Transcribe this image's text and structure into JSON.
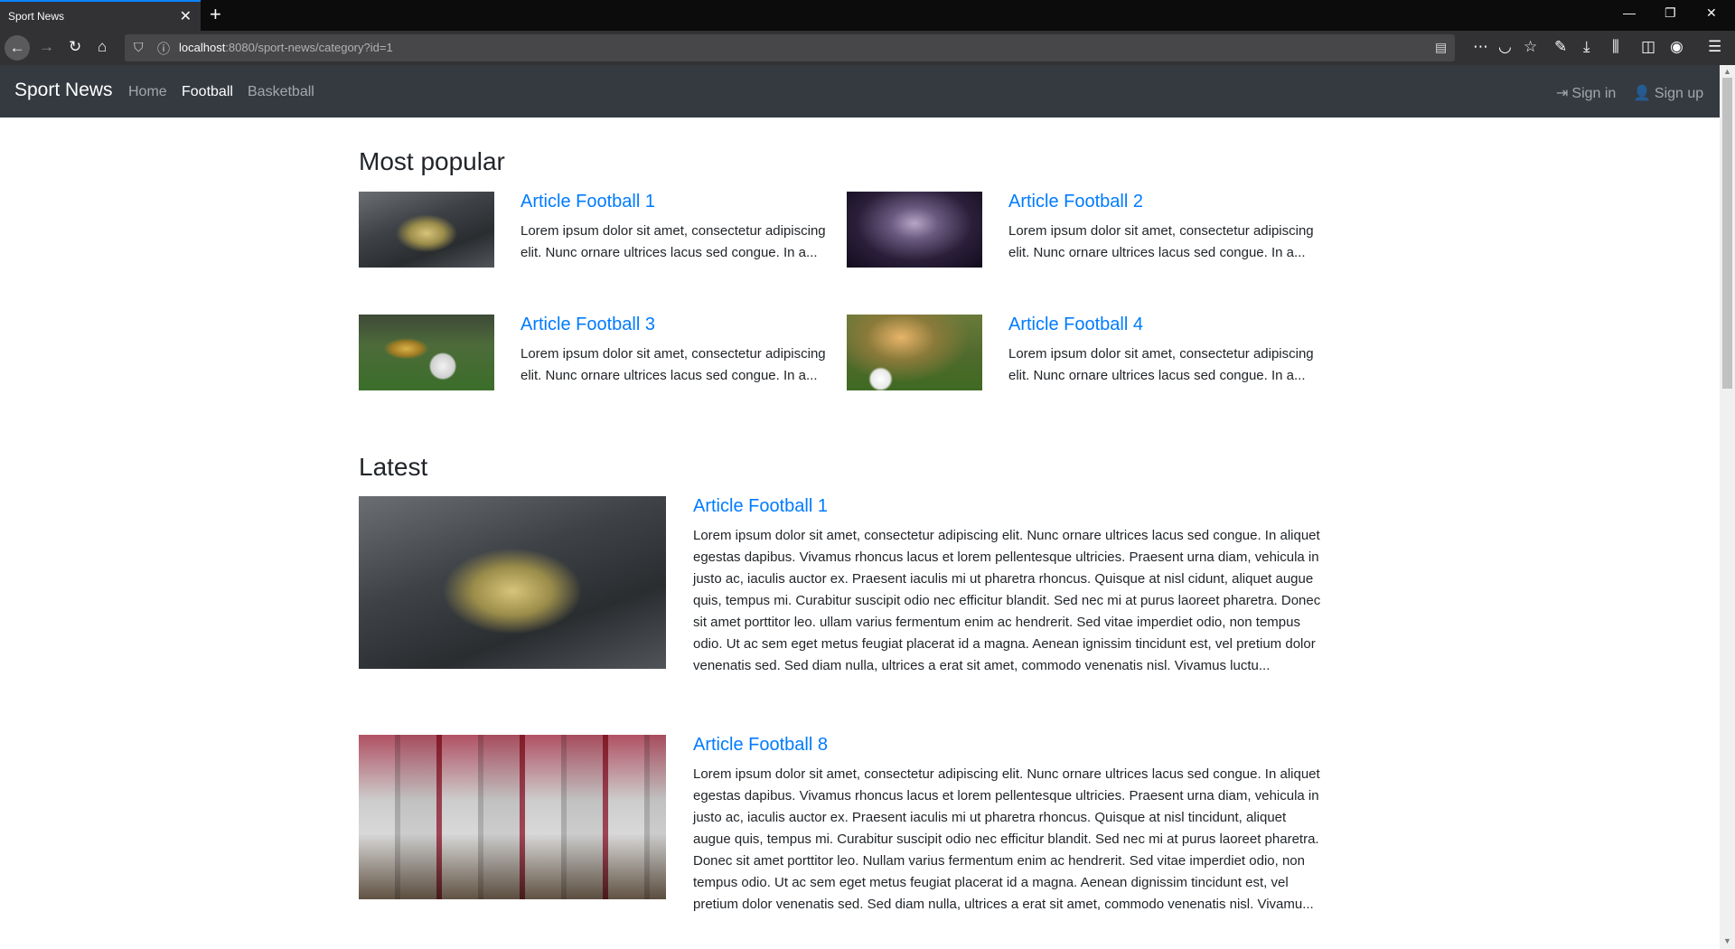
{
  "browser": {
    "tab_title": "Sport News",
    "tab_close": "✕",
    "new_tab": "+",
    "url_host": "localhost",
    "url_path": ":8080/sport-news/category?id=1",
    "window": {
      "minimize": "—",
      "restore": "❐",
      "close": "✕"
    }
  },
  "site": {
    "brand": "Sport News",
    "nav": {
      "home": "Home",
      "football": "Football",
      "basketball": "Basketball"
    },
    "auth": {
      "sign_in": "Sign in",
      "sign_up": "Sign up"
    }
  },
  "most_popular": {
    "title": "Most popular",
    "articles": [
      {
        "title": "Article Football 1",
        "excerpt": "Lorem ipsum dolor sit amet, consectetur adipiscing elit. Nunc ornare ultrices lacus sed congue. In a..."
      },
      {
        "title": "Article Football 2",
        "excerpt": "Lorem ipsum dolor sit amet, consectetur adipiscing elit. Nunc ornare ultrices lacus sed congue. In a..."
      },
      {
        "title": "Article Football 3",
        "excerpt": "Lorem ipsum dolor sit amet, consectetur adipiscing elit. Nunc ornare ultrices lacus sed congue. In a..."
      },
      {
        "title": "Article Football 4",
        "excerpt": "Lorem ipsum dolor sit amet, consectetur adipiscing elit. Nunc ornare ultrices lacus sed congue. In a..."
      }
    ]
  },
  "latest": {
    "title": "Latest",
    "articles": [
      {
        "title": "Article Football 1",
        "excerpt": "Lorem ipsum dolor sit amet, consectetur adipiscing elit. Nunc ornare ultrices lacus sed congue. In aliquet egestas dapibus. Vivamus rhoncus lacus et lorem pellentesque ultricies. Praesent urna diam, vehicula in justo ac, iaculis auctor ex. Praesent iaculis mi ut pharetra rhoncus. Quisque at nisl cidunt, aliquet augue quis, tempus mi. Curabitur suscipit odio nec efficitur blandit. Sed nec mi at purus laoreet pharetra. Donec sit amet porttitor leo. ullam varius fermentum enim ac hendrerit. Sed vitae imperdiet odio, non tempus odio. Ut ac sem eget metus feugiat placerat id a magna. Aenean ignissim tincidunt est, vel pretium dolor venenatis sed. Sed diam nulla, ultrices a erat sit amet, commodo venenatis nisl. Vivamus luctu..."
      },
      {
        "title": "Article Football 8",
        "excerpt": "Lorem ipsum dolor sit amet, consectetur adipiscing elit. Nunc ornare ultrices lacus sed congue. In aliquet egestas dapibus. Vivamus rhoncus lacus et lorem pellentesque ultricies. Praesent urna diam, vehicula in justo ac, iaculis auctor ex. Praesent iaculis mi ut pharetra rhoncus. Quisque at nisl tincidunt, aliquet augue quis, tempus mi. Curabitur suscipit odio nec efficitur blandit. Sed nec mi at purus laoreet pharetra. Donec sit amet porttitor leo. Nullam varius fermentum enim ac hendrerit. Sed vitae imperdiet odio, non tempus odio. Ut ac sem eget metus feugiat placerat id a magna. Aenean dignissim tincidunt est, vel pretium dolor venenatis sed. Sed diam nulla, ultrices a erat sit amet, commodo venenatis nisl. Vivamu..."
      }
    ]
  },
  "colors": {
    "navbar_bg": "#343a40",
    "link": "#007bff",
    "browser_dark": "#323234",
    "tab_accent": "#0a84ff"
  }
}
